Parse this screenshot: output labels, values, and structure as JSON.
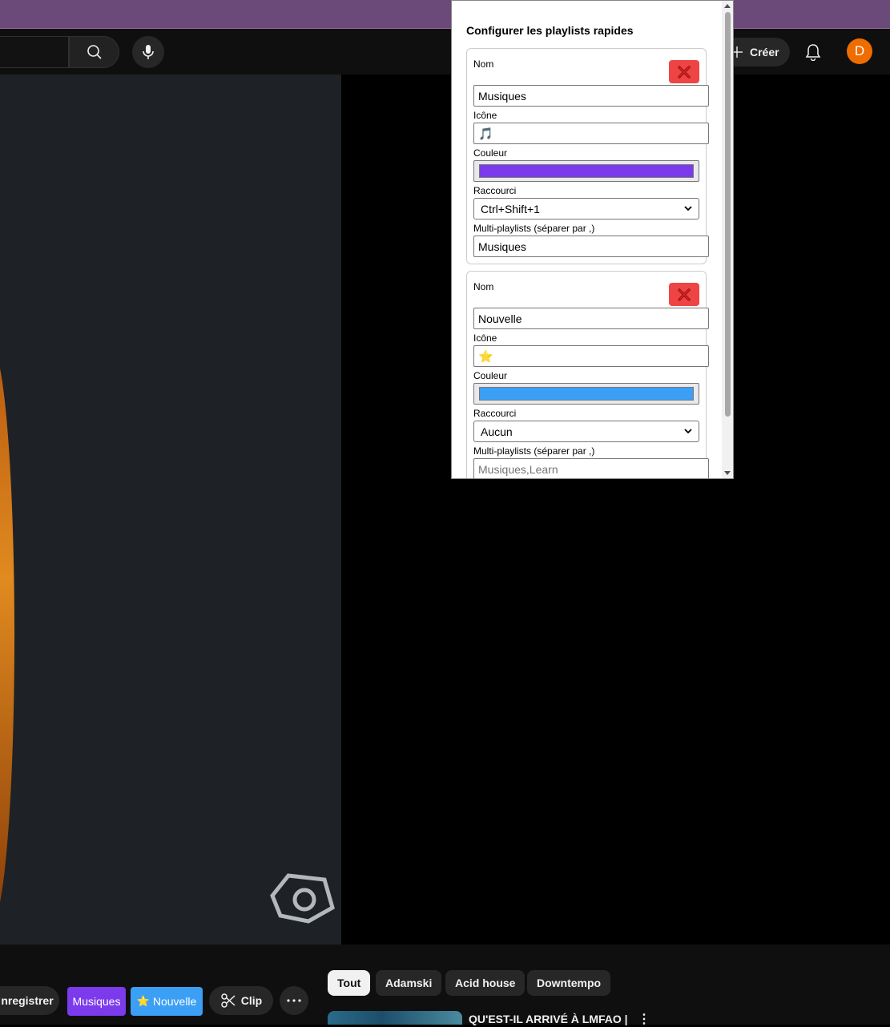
{
  "header": {
    "create_label": "Créer",
    "avatar_letter": "D"
  },
  "actions": {
    "save_label": "nregistrer",
    "quick_playlists": [
      {
        "label": "Musiques",
        "color": "#7c3aed",
        "icon": "music-note"
      },
      {
        "label": "Nouvelle",
        "color": "#3b9ff5",
        "icon": "star"
      }
    ],
    "clip_label": "Clip",
    "more_icon": "ellipsis-icon"
  },
  "chips": [
    {
      "label": "Tout",
      "active": true
    },
    {
      "label": "Adamski",
      "active": false
    },
    {
      "label": "Acid house",
      "active": false
    },
    {
      "label": "Downtempo",
      "active": false
    }
  ],
  "recommendation": {
    "title": "QU'EST-IL ARRIVÉ À LMFAO |"
  },
  "popup": {
    "title": "Configurer les playlists rapides",
    "entries": [
      {
        "name_label": "Nom",
        "name_value": "Musiques",
        "icon_label": "Icône",
        "icon_value": "🎵",
        "color_label": "Couleur",
        "color_value": "#7c3aed",
        "shortcut_label": "Raccourci",
        "shortcut_value": "Ctrl+Shift+1",
        "multi_label": "Multi-playlists (séparer par ,)",
        "multi_value": "Musiques",
        "multi_placeholder": ""
      },
      {
        "name_label": "Nom",
        "name_value": "Nouvelle",
        "icon_label": "Icône",
        "icon_value": "⭐",
        "color_label": "Couleur",
        "color_value": "#3b9ff5",
        "shortcut_label": "Raccourci",
        "shortcut_value": "Aucun",
        "multi_label": "Multi-playlists (séparer par ,)",
        "multi_value": "",
        "multi_placeholder": "Musiques,Learn"
      }
    ]
  }
}
